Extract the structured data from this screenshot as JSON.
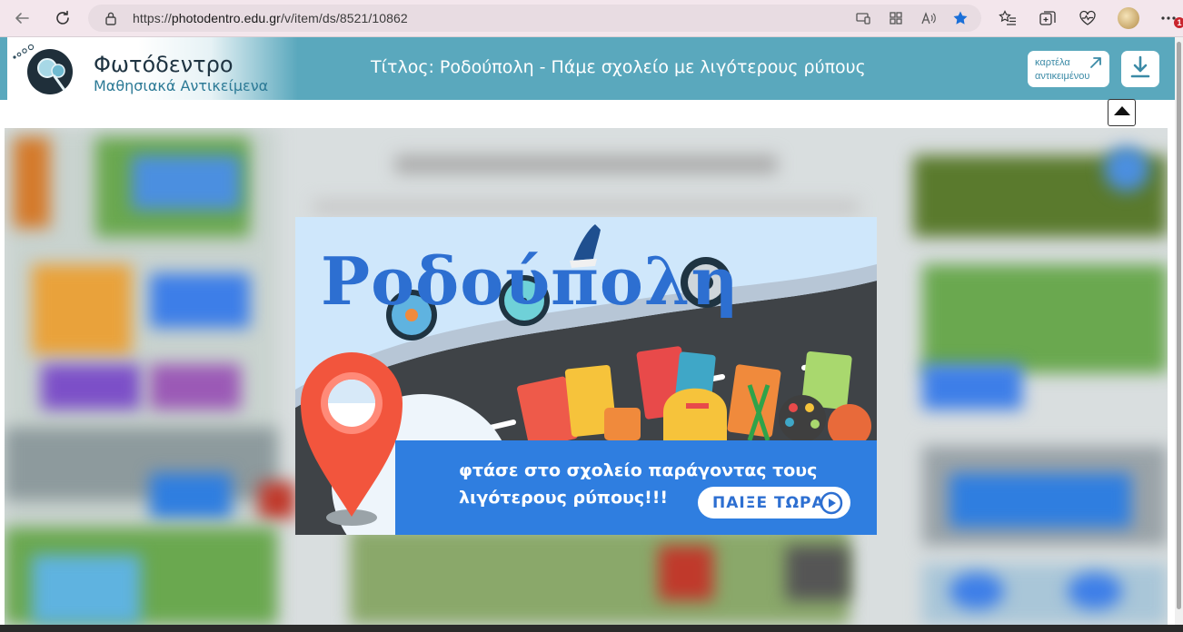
{
  "browser": {
    "url_prefix": "https://",
    "url_host": "photodentro.edu.gr",
    "url_path": "/v/item/ds/8521/10862",
    "notification_count": "1",
    "icons": [
      "back-icon",
      "refresh-icon",
      "lock-icon",
      "screen-cast-icon",
      "apps-grid-icon",
      "read-aloud-icon",
      "favorite-star-icon",
      "favorites-list-icon",
      "collections-icon",
      "heart-pulse-icon",
      "profile-avatar",
      "more-icon"
    ]
  },
  "header": {
    "logo_title": "Φωτόδεντρο",
    "logo_subtitle": "Μαθησιακά Αντικείμενα",
    "title": "Τίτλος:  Ροδούπολη - Πάμε σχολείο με λιγότερους ρύπους",
    "card_button_line1": "καρτέλα",
    "card_button_line2": "αντικειμένου",
    "download_icon": "download-icon",
    "collapse_icon": "triangle-up-icon"
  },
  "game": {
    "title": "Ροδούπολη",
    "tagline_line1": "φτάσε στο σχολείο παράγοντας τους",
    "tagline_line2": "λιγότερους ρύπους!!!",
    "play_label": "ΠΑΙΞΕ ΤΩΡΑ",
    "colors": {
      "sky": "#cfe7fb",
      "title_blue": "#2d6fd1",
      "banner_blue": "#2f7ee0",
      "road": "#3f4347",
      "pin_red": "#f2553d",
      "header_teal": "#5aa8bd"
    }
  }
}
